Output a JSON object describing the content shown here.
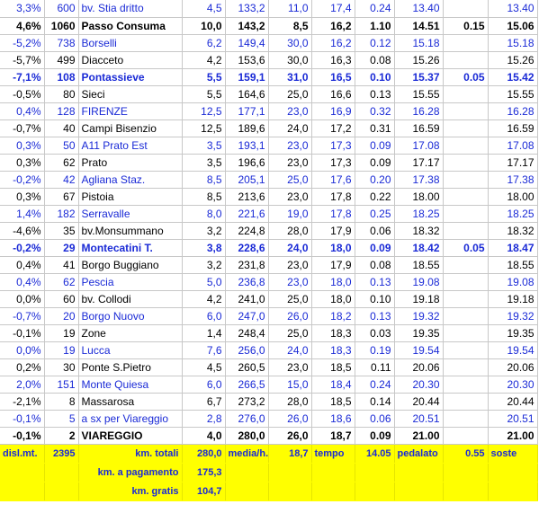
{
  "rows": [
    {
      "pct": "3,3%",
      "alt": "600",
      "name": "bv. Stia   dritto",
      "km": "4,5",
      "tot": "133,2",
      "speed": "11,0",
      "avg": "17,4",
      "time": "0.24",
      "clock": "13.40",
      "stop": "",
      "arr": "13.40",
      "color": "blue",
      "bold": false
    },
    {
      "pct": "4,6%",
      "alt": "1060",
      "name": "Passo Consuma",
      "km": "10,0",
      "tot": "143,2",
      "speed": "8,5",
      "avg": "16,2",
      "time": "1.10",
      "clock": "14.51",
      "stop": "0.15",
      "arr": "15.06",
      "color": "black",
      "bold": true
    },
    {
      "pct": "-5,2%",
      "alt": "738",
      "name": "Borselli",
      "km": "6,2",
      "tot": "149,4",
      "speed": "30,0",
      "avg": "16,2",
      "time": "0.12",
      "clock": "15.18",
      "stop": "",
      "arr": "15.18",
      "color": "blue",
      "bold": false
    },
    {
      "pct": "-5,7%",
      "alt": "499",
      "name": "Diacceto",
      "km": "4,2",
      "tot": "153,6",
      "speed": "30,0",
      "avg": "16,3",
      "time": "0.08",
      "clock": "15.26",
      "stop": "",
      "arr": "15.26",
      "color": "black",
      "bold": false
    },
    {
      "pct": "-7,1%",
      "alt": "108",
      "name": "Pontassieve",
      "km": "5,5",
      "tot": "159,1",
      "speed": "31,0",
      "avg": "16,5",
      "time": "0.10",
      "clock": "15.37",
      "stop": "0.05",
      "arr": "15.42",
      "color": "blue",
      "bold": true
    },
    {
      "pct": "-0,5%",
      "alt": "80",
      "name": "Sieci",
      "km": "5,5",
      "tot": "164,6",
      "speed": "25,0",
      "avg": "16,6",
      "time": "0.13",
      "clock": "15.55",
      "stop": "",
      "arr": "15.55",
      "color": "black",
      "bold": false
    },
    {
      "pct": "0,4%",
      "alt": "128",
      "name": "FIRENZE",
      "km": "12,5",
      "tot": "177,1",
      "speed": "23,0",
      "avg": "16,9",
      "time": "0.32",
      "clock": "16.28",
      "stop": "",
      "arr": "16.28",
      "color": "blue",
      "bold": false
    },
    {
      "pct": "-0,7%",
      "alt": "40",
      "name": "Campi Bisenzio",
      "km": "12,5",
      "tot": "189,6",
      "speed": "24,0",
      "avg": "17,2",
      "time": "0.31",
      "clock": "16.59",
      "stop": "",
      "arr": "16.59",
      "color": "black",
      "bold": false
    },
    {
      "pct": "0,3%",
      "alt": "50",
      "name": "A11 Prato Est",
      "km": "3,5",
      "tot": "193,1",
      "speed": "23,0",
      "avg": "17,3",
      "time": "0.09",
      "clock": "17.08",
      "stop": "",
      "arr": "17.08",
      "color": "blue",
      "bold": false
    },
    {
      "pct": "0,3%",
      "alt": "62",
      "name": "Prato",
      "km": "3,5",
      "tot": "196,6",
      "speed": "23,0",
      "avg": "17,3",
      "time": "0.09",
      "clock": "17.17",
      "stop": "",
      "arr": "17.17",
      "color": "black",
      "bold": false
    },
    {
      "pct": "-0,2%",
      "alt": "42",
      "name": "Agliana Staz.",
      "km": "8,5",
      "tot": "205,1",
      "speed": "25,0",
      "avg": "17,6",
      "time": "0.20",
      "clock": "17.38",
      "stop": "",
      "arr": "17.38",
      "color": "blue",
      "bold": false
    },
    {
      "pct": "0,3%",
      "alt": "67",
      "name": "Pistoia",
      "km": "8,5",
      "tot": "213,6",
      "speed": "23,0",
      "avg": "17,8",
      "time": "0.22",
      "clock": "18.00",
      "stop": "",
      "arr": "18.00",
      "color": "black",
      "bold": false
    },
    {
      "pct": "1,4%",
      "alt": "182",
      "name": "Serravalle",
      "km": "8,0",
      "tot": "221,6",
      "speed": "19,0",
      "avg": "17,8",
      "time": "0.25",
      "clock": "18.25",
      "stop": "",
      "arr": "18.25",
      "color": "blue",
      "bold": false
    },
    {
      "pct": "-4,6%",
      "alt": "35",
      "name": "bv.Monsummano",
      "km": "3,2",
      "tot": "224,8",
      "speed": "28,0",
      "avg": "17,9",
      "time": "0.06",
      "clock": "18.32",
      "stop": "",
      "arr": "18.32",
      "color": "black",
      "bold": false
    },
    {
      "pct": "-0,2%",
      "alt": "29",
      "name": "Montecatini T.",
      "km": "3,8",
      "tot": "228,6",
      "speed": "24,0",
      "avg": "18,0",
      "time": "0.09",
      "clock": "18.42",
      "stop": "0.05",
      "arr": "18.47",
      "color": "blue",
      "bold": true
    },
    {
      "pct": "0,4%",
      "alt": "41",
      "name": "Borgo Buggiano",
      "km": "3,2",
      "tot": "231,8",
      "speed": "23,0",
      "avg": "17,9",
      "time": "0.08",
      "clock": "18.55",
      "stop": "",
      "arr": "18.55",
      "color": "black",
      "bold": false
    },
    {
      "pct": "0,4%",
      "alt": "62",
      "name": "Pescia",
      "km": "5,0",
      "tot": "236,8",
      "speed": "23,0",
      "avg": "18,0",
      "time": "0.13",
      "clock": "19.08",
      "stop": "",
      "arr": "19.08",
      "color": "blue",
      "bold": false
    },
    {
      "pct": "0,0%",
      "alt": "60",
      "name": "bv. Collodi",
      "km": "4,2",
      "tot": "241,0",
      "speed": "25,0",
      "avg": "18,0",
      "time": "0.10",
      "clock": "19.18",
      "stop": "",
      "arr": "19.18",
      "color": "black",
      "bold": false
    },
    {
      "pct": "-0,7%",
      "alt": "20",
      "name": "Borgo Nuovo",
      "km": "6,0",
      "tot": "247,0",
      "speed": "26,0",
      "avg": "18,2",
      "time": "0.13",
      "clock": "19.32",
      "stop": "",
      "arr": "19.32",
      "color": "blue",
      "bold": false
    },
    {
      "pct": "-0,1%",
      "alt": "19",
      "name": "Zone",
      "km": "1,4",
      "tot": "248,4",
      "speed": "25,0",
      "avg": "18,3",
      "time": "0.03",
      "clock": "19.35",
      "stop": "",
      "arr": "19.35",
      "color": "black",
      "bold": false
    },
    {
      "pct": "0,0%",
      "alt": "19",
      "name": "Lucca",
      "km": "7,6",
      "tot": "256,0",
      "speed": "24,0",
      "avg": "18,3",
      "time": "0.19",
      "clock": "19.54",
      "stop": "",
      "arr": "19.54",
      "color": "blue",
      "bold": false
    },
    {
      "pct": "0,2%",
      "alt": "30",
      "name": "Ponte S.Pietro",
      "km": "4,5",
      "tot": "260,5",
      "speed": "23,0",
      "avg": "18,5",
      "time": "0.11",
      "clock": "20.06",
      "stop": "",
      "arr": "20.06",
      "color": "black",
      "bold": false
    },
    {
      "pct": "2,0%",
      "alt": "151",
      "name": "Monte Quiesa",
      "km": "6,0",
      "tot": "266,5",
      "speed": "15,0",
      "avg": "18,4",
      "time": "0.24",
      "clock": "20.30",
      "stop": "",
      "arr": "20.30",
      "color": "blue",
      "bold": false
    },
    {
      "pct": "-2,1%",
      "alt": "8",
      "name": "Massarosa",
      "km": "6,7",
      "tot": "273,2",
      "speed": "28,0",
      "avg": "18,5",
      "time": "0.14",
      "clock": "20.44",
      "stop": "",
      "arr": "20.44",
      "color": "black",
      "bold": false
    },
    {
      "pct": "-0,1%",
      "alt": "5",
      "name": "a sx per Viareggio",
      "km": "2,8",
      "tot": "276,0",
      "speed": "26,0",
      "avg": "18,6",
      "time": "0.06",
      "clock": "20.51",
      "stop": "",
      "arr": "20.51",
      "color": "blue",
      "bold": false
    },
    {
      "pct": "-0,1%",
      "alt": "2",
      "name": "VIAREGGIO",
      "km": "4,0",
      "tot": "280,0",
      "speed": "26,0",
      "avg": "18,7",
      "time": "0.09",
      "clock": "21.00",
      "stop": "",
      "arr": "21.00",
      "color": "black",
      "bold": true
    }
  ],
  "summary": {
    "dislmt_label": "disl.mt.",
    "dislmt_value": "2395",
    "km_totali_label": "km. totali",
    "km_totali_value": "280,0",
    "media_label": "media/h.",
    "media_value": "18,7",
    "tempo_label": "tempo",
    "tempo_value": "14.05",
    "pedalato_label": "pedalato",
    "soste_value": "0.55",
    "soste_label": "soste",
    "km_pagamento_label": "km. a pagamento",
    "km_pagamento_value": "175,3",
    "km_gratis_label": "km. gratis",
    "km_gratis_value": "104,7"
  },
  "colors": {
    "blue": "#1a2ad6",
    "black": "#000000",
    "summary_bg": "#ffff00"
  }
}
